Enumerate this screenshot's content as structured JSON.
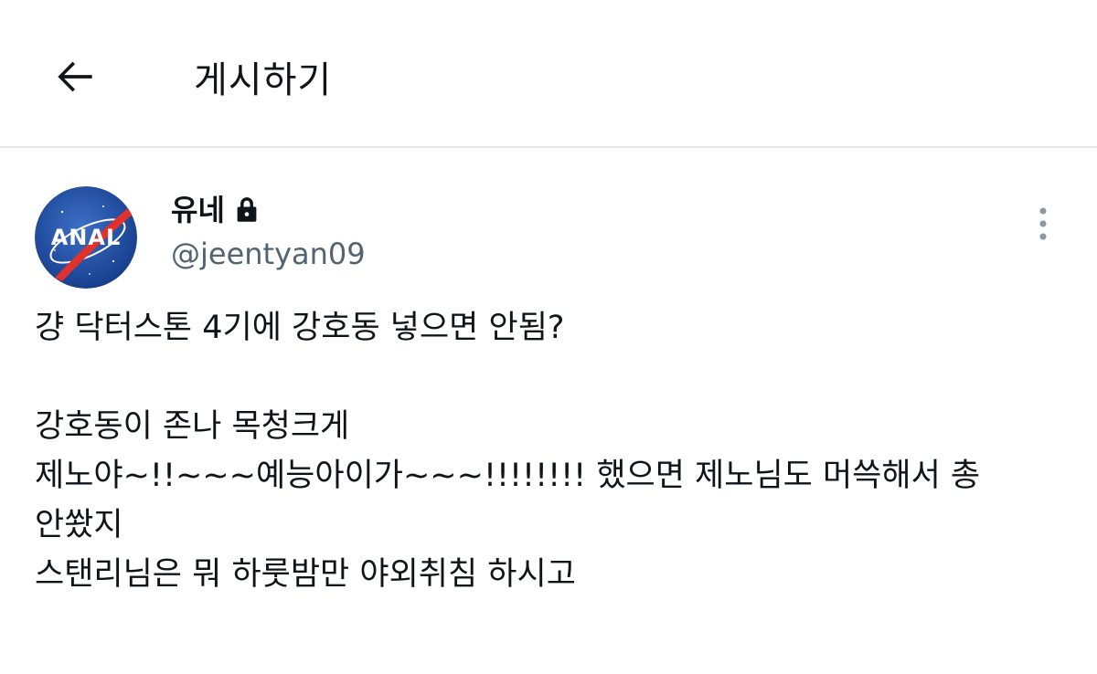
{
  "header": {
    "title": "게시하기",
    "back_icon": "arrow-left-icon"
  },
  "post": {
    "display_name": "유네",
    "protected_icon": "lock-icon",
    "handle": "@jeentyan09",
    "avatar_text": "ANAL",
    "more_icon": "more-vertical-icon",
    "lines": [
      "걍 닥터스톤 4기에 강호동 넣으면 안됨?",
      "",
      "강호동이 존나 목청크게",
      "제노야~!!~~~예능아이가~~~!!!!!!!! 했으면 제노님도 머쓱해서 총",
      "안쐈지",
      "스탠리님은 뭐 하룻밤만 야외취침 하시고"
    ]
  },
  "colors": {
    "text_primary": "#0f1419",
    "text_secondary": "#536471",
    "divider": "#e6e9ec",
    "avatar_blue": "#1f4ea3",
    "avatar_red": "#e0322d"
  }
}
